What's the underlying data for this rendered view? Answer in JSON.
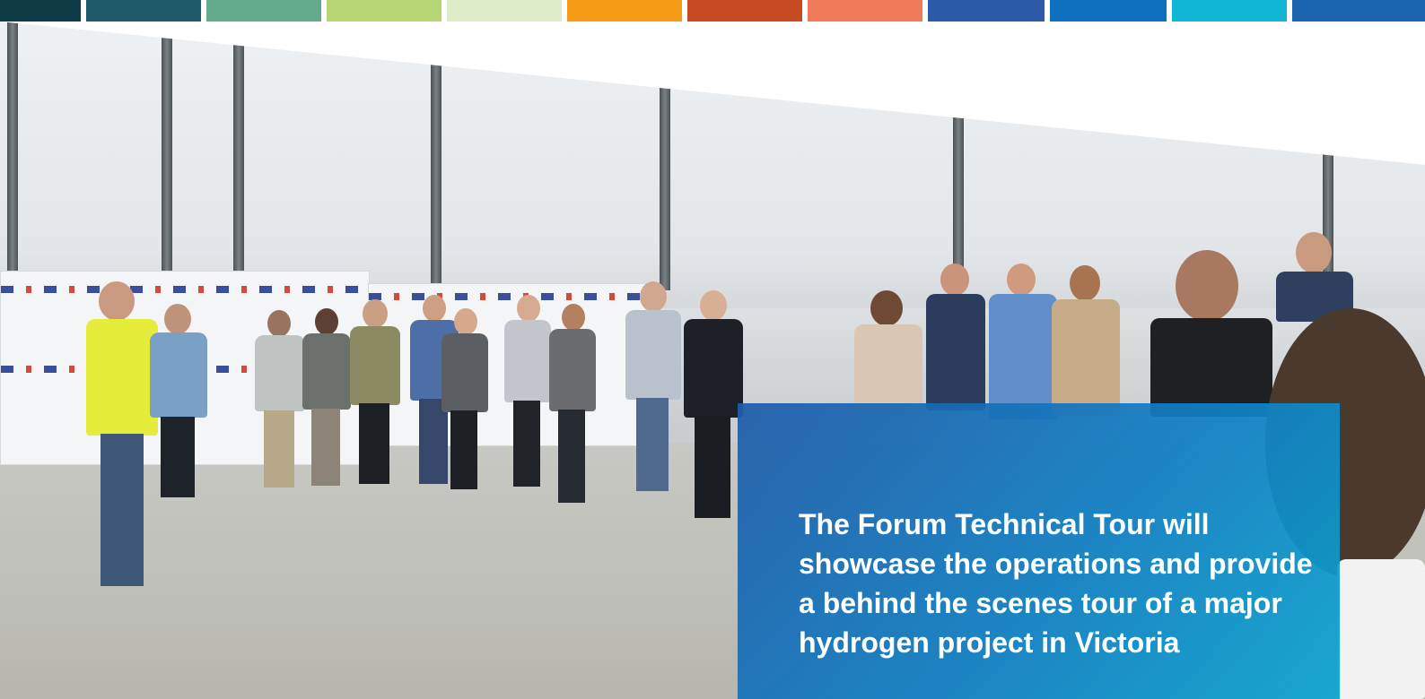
{
  "color_bar": {
    "segments": [
      "#0d3b46",
      "#1e5a6a",
      "#63a98c",
      "#b9d675",
      "#deecc9",
      "#f39a14",
      "#c84a22",
      "#ef7b5a",
      "#2a5aa8",
      "#0f70bf",
      "#10b4d4",
      "#1c63b0"
    ]
  },
  "info_box": {
    "text": "The Forum Technical Tour will showcase the operations and provide a behind the scenes tour of a major hydrogen project in Victoria"
  }
}
